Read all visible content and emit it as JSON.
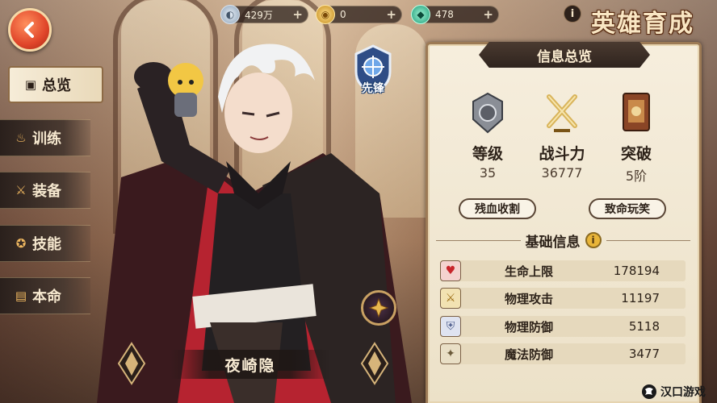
{
  "page_title": "英雄育成",
  "currencies": [
    {
      "icon": "silver-coin-icon",
      "value": "429万"
    },
    {
      "icon": "gold-coin-icon",
      "value": "0"
    },
    {
      "icon": "gem-icon",
      "value": "478"
    }
  ],
  "tabs": [
    {
      "label": "总览",
      "icon": "overview-icon",
      "active": true
    },
    {
      "label": "训练",
      "icon": "flame-icon",
      "active": false
    },
    {
      "label": "装备",
      "icon": "sword-icon",
      "active": false
    },
    {
      "label": "技能",
      "icon": "star-icon",
      "active": false
    },
    {
      "label": "本命",
      "icon": "card-icon",
      "active": false
    }
  ],
  "hero": {
    "name": "夜崎隐",
    "class_label": "先锋"
  },
  "panel": {
    "title": "信息总览",
    "stats": [
      {
        "label": "等级",
        "value": "35",
        "icon": "level-badge-icon"
      },
      {
        "label": "战斗力",
        "value": "36777",
        "icon": "crossed-swords-icon"
      },
      {
        "label": "突破",
        "value": "5阶",
        "icon": "breakthrough-book-icon"
      }
    ],
    "skills": [
      "残血收割",
      "致命玩笑"
    ],
    "base_info_title": "基础信息",
    "attributes": [
      {
        "name": "生命上限",
        "value": "178194",
        "icon": "heart-icon"
      },
      {
        "name": "物理攻击",
        "value": "11197",
        "icon": "physical-attack-icon"
      },
      {
        "name": "物理防御",
        "value": "5118",
        "icon": "physical-defense-icon"
      },
      {
        "name": "魔法防御",
        "value": "3477",
        "icon": "magic-defense-icon"
      }
    ]
  },
  "watermark": "汉口游戏"
}
